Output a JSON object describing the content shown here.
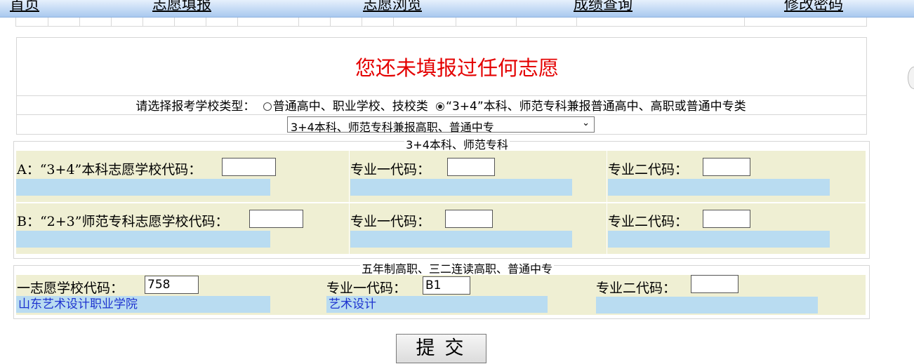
{
  "nav": {
    "items": [
      {
        "label": "首页"
      },
      {
        "label": "志愿填报"
      },
      {
        "label": "志愿浏览"
      },
      {
        "label": "成绩查询"
      },
      {
        "label": "修改密码"
      }
    ]
  },
  "notice": {
    "message": "您还未填报过任何志愿"
  },
  "school_type": {
    "prompt": "请选择报考学校类型：",
    "options": [
      {
        "label": "普通高中、职业学校、技校类",
        "selected": false
      },
      {
        "label": "“3+4”本科、师范专科兼报普通高中、高职或普通中专类",
        "selected": true
      }
    ],
    "select_value": "3+4本科、师范专科兼报高职、普通中专"
  },
  "section_a": {
    "legend": "3+4本科、师范专科",
    "rows": [
      {
        "school_label": "A：“3+4”本科志愿学校代码：",
        "school_value": "",
        "school_name": "",
        "major1_label": "专业一代码：",
        "major1_value": "",
        "major1_name": "",
        "major2_label": "专业二代码：",
        "major2_value": "",
        "major2_name": ""
      },
      {
        "school_label": "B：“2+3”师范专科志愿学校代码：",
        "school_value": "",
        "school_name": "",
        "major1_label": "专业一代码：",
        "major1_value": "",
        "major1_name": "",
        "major2_label": "专业二代码：",
        "major2_value": "",
        "major2_name": ""
      }
    ]
  },
  "section_b": {
    "legend": "五年制高职、三二连读高职、普通中专",
    "school_label": "一志愿学校代码：",
    "school_value": "758",
    "school_name": "山东艺术设计职业学院",
    "major1_label": "专业一代码：",
    "major1_value": "B1",
    "major1_name": "艺术设计",
    "major2_label": "专业二代码：",
    "major2_value": "",
    "major2_name": ""
  },
  "submit": {
    "label": "提交"
  },
  "colors": {
    "notice": "#e40000",
    "cell_background": "#efefd3",
    "name_background": "#b9dcf1",
    "name_text": "#1d33cf"
  }
}
